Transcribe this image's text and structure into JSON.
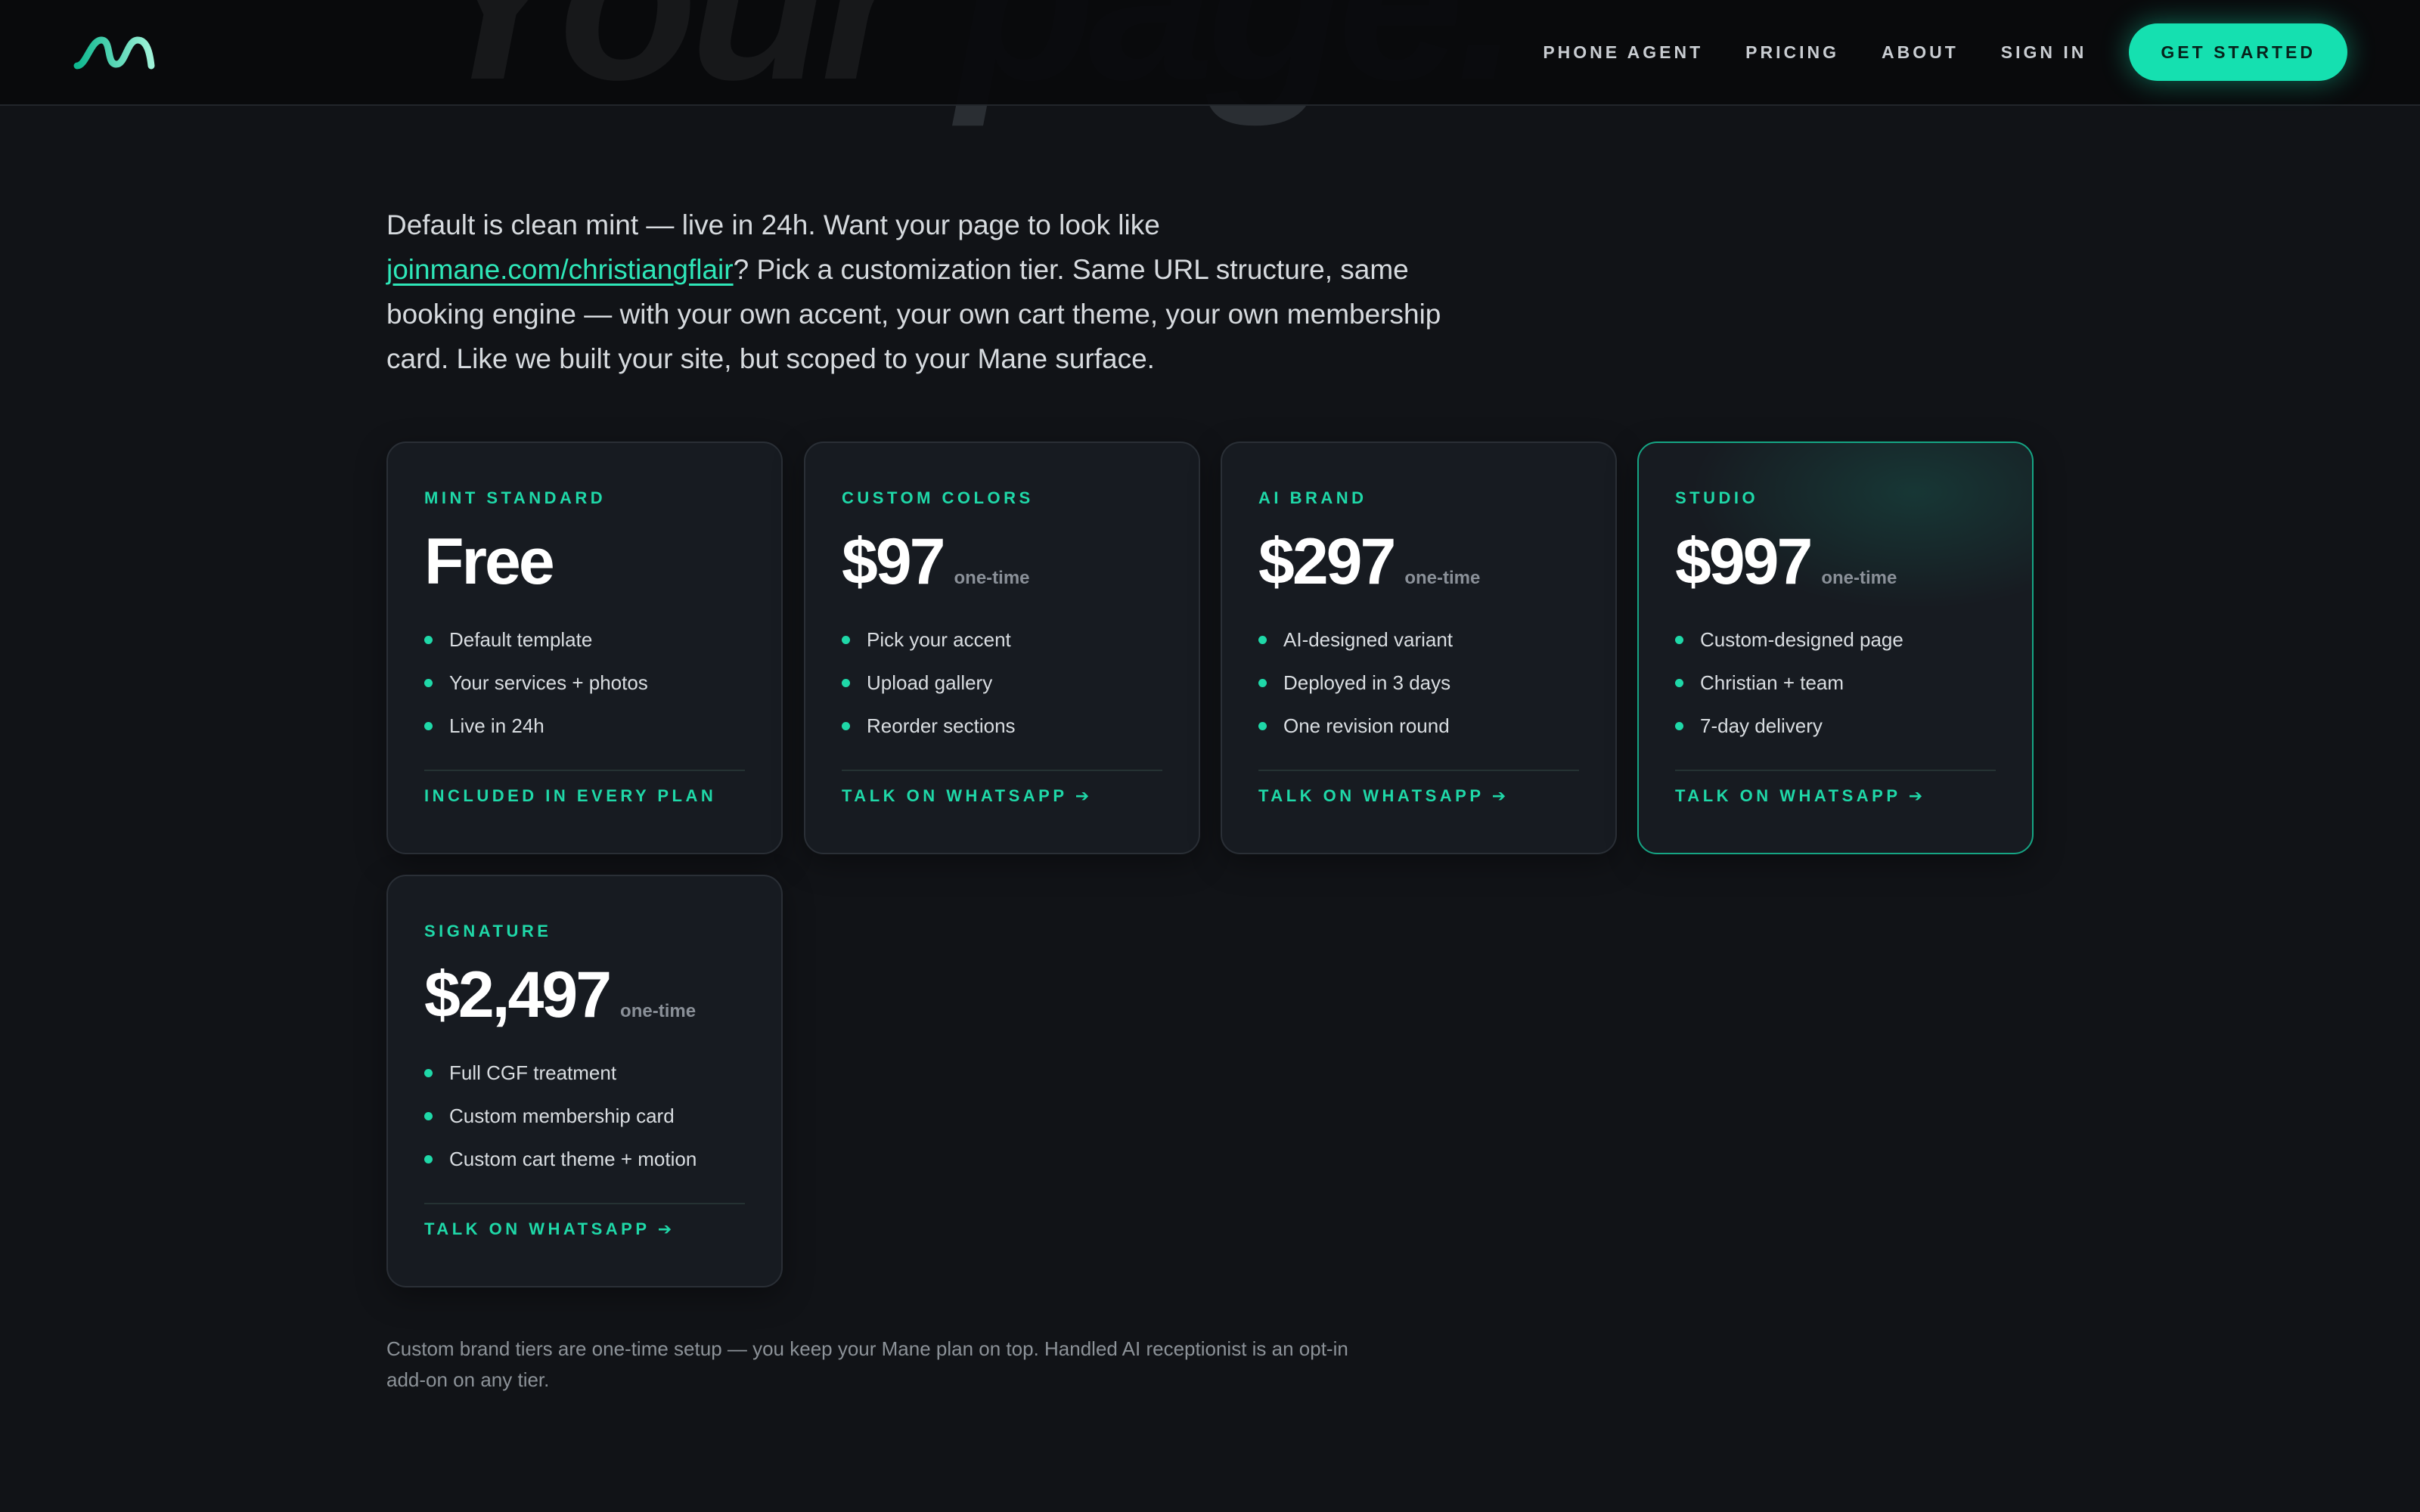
{
  "hero": {
    "text_main": "Your ",
    "text_fade": "page."
  },
  "header": {
    "logo_name": "mane-logo",
    "nav": [
      "PHONE AGENT",
      "PRICING",
      "ABOUT",
      "SIGN IN"
    ],
    "cta_label": "GET STARTED"
  },
  "intro": {
    "before_link": "Default is clean mint — live in 24h. Want your page to look like ",
    "link_text": "joinmane.com/christiangflair",
    "after_link": "? Pick a customization tier. Same URL structure, same booking engine — with your own accent, your own cart theme, your own membership card. Like we built your site, but scoped to your Mane surface."
  },
  "tiers": [
    {
      "name": "MINT STANDARD",
      "price": "Free",
      "per": "",
      "features": [
        "Default template",
        "Your services + photos",
        "Live in 24h"
      ],
      "link": "INCLUDED IN EVERY PLAN"
    },
    {
      "name": "CUSTOM COLORS",
      "price": "$97",
      "per": "one-time",
      "features": [
        "Pick your accent",
        "Upload gallery",
        "Reorder sections"
      ],
      "link": "TALK ON WHATSAPP ➔"
    },
    {
      "name": "AI BRAND",
      "price": "$297",
      "per": "one-time",
      "features": [
        "AI-designed variant",
        "Deployed in 3 days",
        "One revision round"
      ],
      "link": "TALK ON WHATSAPP ➔"
    },
    {
      "name": "STUDIO",
      "price": "$997",
      "per": "one-time",
      "features": [
        "Custom-designed page",
        "Christian + team",
        "7-day delivery"
      ],
      "link": "TALK ON WHATSAPP ➔"
    },
    {
      "name": "SIGNATURE",
      "price": "$2,497",
      "per": "one-time",
      "features": [
        "Full CGF treatment",
        "Custom membership card",
        "Custom cart theme + motion"
      ],
      "link": "TALK ON WHATSAPP ➔"
    }
  ],
  "note": "Custom brand tiers are one-time setup — you keep your Mane plan on top. Handled AI receptionist is an opt-in add-on on any tier.",
  "colors": {
    "accent": "#15e0b0",
    "background": "#111317",
    "card": "#171b21"
  }
}
